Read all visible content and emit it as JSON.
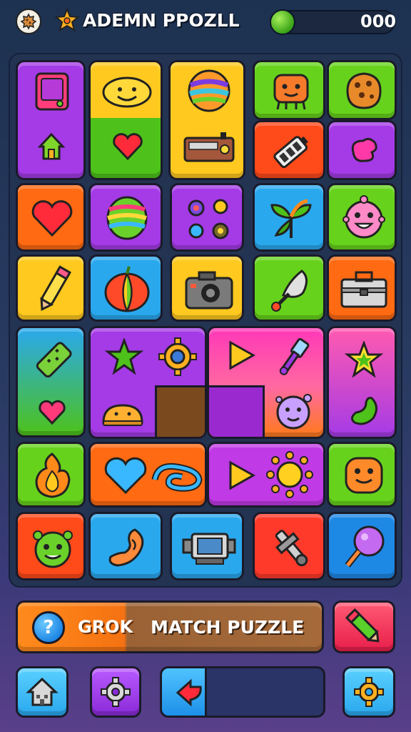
{
  "header": {
    "title": "ADEMN PPOZLL",
    "score": "000",
    "icons": {
      "back": "cookie-icon",
      "logo": "puzzle-star-icon"
    }
  },
  "board": {
    "tiles": [
      {
        "name": "tile-tablet-house",
        "icons": [
          "tablet-icon",
          "house-icon"
        ]
      },
      {
        "name": "tile-smiley-heart",
        "icons": [
          "smiley-icon",
          "heart-icon"
        ]
      },
      {
        "name": "tile-ball-radio",
        "icons": [
          "striped-ball-icon",
          "radio-icon"
        ]
      },
      {
        "name": "tile-robot",
        "icons": [
          "robot-icon"
        ]
      },
      {
        "name": "tile-cookie",
        "icons": [
          "cookie-icon"
        ]
      },
      {
        "name": "tile-battery",
        "icons": [
          "battery-icon"
        ]
      },
      {
        "name": "tile-blob",
        "icons": [
          "blob-icon"
        ]
      },
      {
        "name": "tile-heart",
        "icons": [
          "heart-icon"
        ]
      },
      {
        "name": "tile-striped-ball",
        "icons": [
          "striped-ball-icon"
        ]
      },
      {
        "name": "tile-gadgets",
        "icons": [
          "gadgets-icon"
        ]
      },
      {
        "name": "tile-leaf",
        "icons": [
          "leaf-icon"
        ]
      },
      {
        "name": "tile-monster",
        "icons": [
          "monster-icon"
        ]
      },
      {
        "name": "tile-pencil",
        "icons": [
          "pencil-icon"
        ]
      },
      {
        "name": "tile-pumpkin",
        "icons": [
          "pumpkin-icon"
        ]
      },
      {
        "name": "tile-camera",
        "icons": [
          "camera-icon"
        ]
      },
      {
        "name": "tile-bell",
        "icons": [
          "bell-icon"
        ]
      },
      {
        "name": "tile-toolbox",
        "icons": [
          "toolbox-icon"
        ]
      },
      {
        "name": "tile-candy-heart",
        "icons": [
          "candy-icon",
          "heart-icon"
        ]
      },
      {
        "name": "tile-star-gear",
        "icons": [
          "star-icon",
          "gear-icon",
          "bun-icon"
        ]
      },
      {
        "name": "tile-play-key",
        "icons": [
          "play-icon",
          "key-icon",
          "creature-icon"
        ]
      },
      {
        "name": "tile-star-bean",
        "icons": [
          "star-icon",
          "bean-icon"
        ]
      },
      {
        "name": "tile-flame",
        "icons": [
          "flame-icon"
        ]
      },
      {
        "name": "tile-heart-swirl",
        "icons": [
          "heart-icon",
          "swirl-icon"
        ]
      },
      {
        "name": "tile-play-sun",
        "icons": [
          "play-icon",
          "sun-icon"
        ]
      },
      {
        "name": "tile-face",
        "icons": [
          "face-icon"
        ]
      },
      {
        "name": "tile-frog",
        "icons": [
          "frog-icon"
        ]
      },
      {
        "name": "tile-ear",
        "icons": [
          "ear-icon"
        ]
      },
      {
        "name": "tile-projector",
        "icons": [
          "projector-icon"
        ]
      },
      {
        "name": "tile-wrench",
        "icons": [
          "wrench-icon"
        ]
      },
      {
        "name": "tile-mirror",
        "icons": [
          "mirror-icon"
        ]
      }
    ]
  },
  "bottom_bar": {
    "help_label": "?",
    "left_label": "GROK",
    "right_label": "MATCH PUZZLE"
  },
  "nav": {
    "home": "home-icon",
    "settings": "gear-icon",
    "progress_fraction": 0.28,
    "options": "gear-icon"
  },
  "colors": {
    "purple": "#a43be6",
    "yellow": "#ffc91f",
    "green": "#67d21c",
    "orange": "#ff7a12",
    "blue": "#2aa8ee",
    "red": "#ff4a3a"
  }
}
